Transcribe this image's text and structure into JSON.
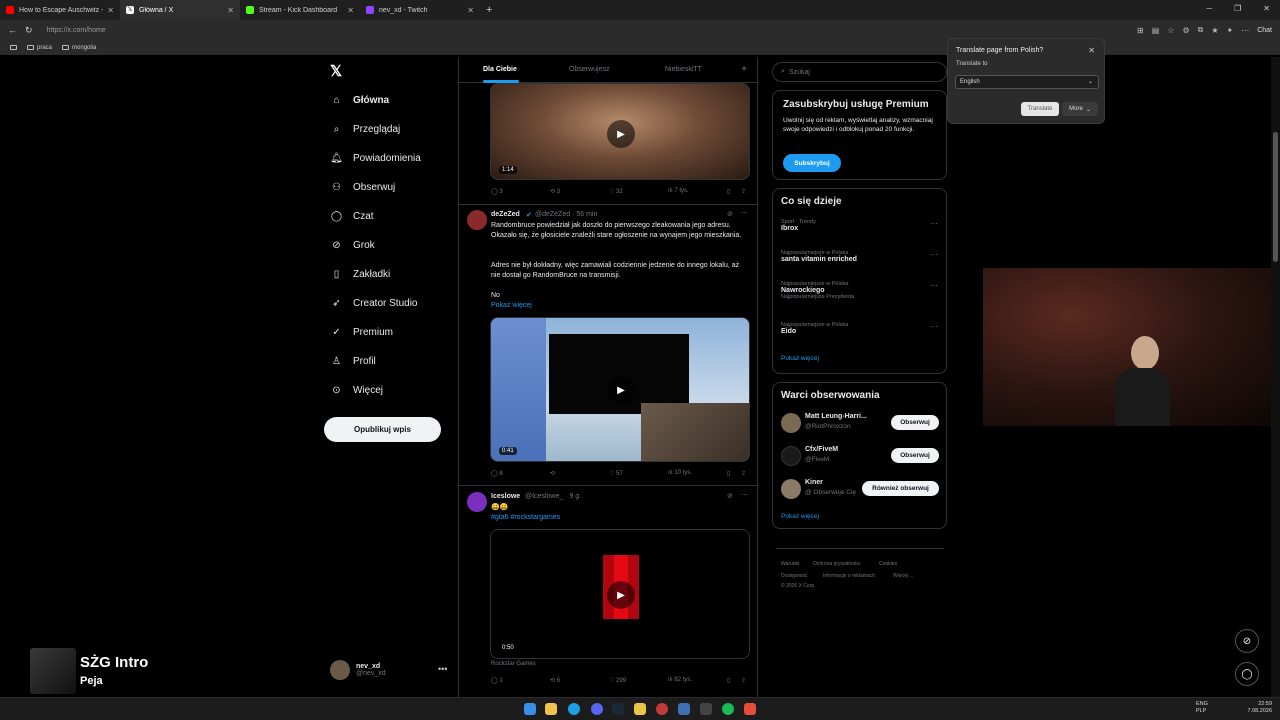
{
  "browser": {
    "tabs": [
      {
        "title": "How to Escape Auschwitz - YouTub",
        "color": "#ff0000"
      },
      {
        "title": "Główna / X",
        "color": "#ffffff"
      },
      {
        "title": "Stream - Kick Dashboard",
        "color": "#53fc18"
      },
      {
        "title": "nev_xd - Twitch",
        "color": "#9146ff"
      }
    ],
    "url": "https://x.com/home",
    "bookmarks": [
      "praca",
      "mongolia"
    ],
    "chat_label": "Chat"
  },
  "left_nav": {
    "items": [
      {
        "label": "Główna",
        "icon": "home-icon"
      },
      {
        "label": "Przeglądaj",
        "icon": "search-icon"
      },
      {
        "label": "Powiadomienia",
        "icon": "bell-icon"
      },
      {
        "label": "Obserwuj",
        "icon": "follow-icon"
      },
      {
        "label": "Czat",
        "icon": "chat-icon"
      },
      {
        "label": "Grok",
        "icon": "grok-icon"
      },
      {
        "label": "Zakładki",
        "icon": "bookmark-icon"
      },
      {
        "label": "Creator Studio",
        "icon": "creator-icon"
      },
      {
        "label": "Premium",
        "icon": "premium-icon"
      },
      {
        "label": "Profil",
        "icon": "profile-icon"
      },
      {
        "label": "Więcej",
        "icon": "more-icon"
      }
    ],
    "post_button": "Opublikuj wpis",
    "account": {
      "name": "nev_xd",
      "handle": "@nev_xd"
    }
  },
  "feed": {
    "tabs": [
      "Dla Ciebie",
      "Obserwujesz",
      "NiebieskiTT"
    ],
    "tweet1": {
      "duration": "1:14",
      "replies": "3",
      "reposts": "3",
      "likes": "32",
      "views": "7 tys."
    },
    "tweet2": {
      "name": "deZeZed",
      "handle": "@deZeZed · 56 min",
      "p1": "Randombruce powiedział jak doszło do pierwszego zleakowania jego adresu. Okazało się, że głosiciele znaleźli stare ogłoszenie na wynajem jego mieszkania.",
      "p2": "Adres nie był dokładny, więc zamawiali codziennie jedzenie do innego lokalu, aż nie dostał go RandomBruce na transmisji.",
      "p3": "No",
      "show_more": "Pokaż więcej",
      "duration": "0:41",
      "replies": "8",
      "reposts": "",
      "likes": "57",
      "views": "10 tys."
    },
    "tweet3": {
      "name": "Iceslowe",
      "handle": "@Iceslowe_ · 9 g.",
      "emoji": "😀😀",
      "hashtags": "#gta6 #rockstargames",
      "duration": "0:50",
      "source": "Rockstar Games",
      "replies": "1",
      "reposts": "6",
      "likes": "299",
      "views": "82 tys."
    }
  },
  "right": {
    "search_placeholder": "Szukaj",
    "premium": {
      "title": "Zasubskrybuj usługę Premium",
      "text": "Uwolnij się od reklam, wyświetlaj analizy, wzmacniaj swoje odpowiedzi i odblokuj ponad 20 funkcji.",
      "button": "Subskrybuj"
    },
    "trends": {
      "title": "Co się dzieje",
      "items": [
        {
          "cat": "Sport · Trendy",
          "name": "Ibrox",
          "extra": ""
        },
        {
          "cat": "Najpopularniejsze w Polska",
          "name": "santa vitamin enriched",
          "extra": ""
        },
        {
          "cat": "Najpopularniejsze w Polska",
          "name": "Nawrockiego",
          "extra": "Najpopularniejsze Prezydenta"
        },
        {
          "cat": "Najpopularniejsze w Polska",
          "name": "Eido",
          "extra": ""
        }
      ],
      "show_more": "Pokaż więcej"
    },
    "who_to_follow": {
      "title": "Warci obserwowania",
      "items": [
        {
          "name": "Matt Leung-Harri...",
          "handle": "@RiotPhroxzon",
          "button": "Obserwuj",
          "color": "#7a6a55"
        },
        {
          "name": "Cfx/FiveM",
          "handle": "@FiveM",
          "button": "Obserwuj",
          "color": "#1a1a1a"
        },
        {
          "name": "Kiner",
          "handle": "@ Obserwuje Cię",
          "button": "Również obserwuj",
          "color": "#8a7a66"
        }
      ],
      "show_more": "Pokaż więcej"
    },
    "footer": {
      "line1": [
        "Warunki",
        "Ochrona prywatności",
        "Cookies"
      ],
      "line2": [
        "Dostępność",
        "Informacje o reklamach",
        "Więcej ..."
      ],
      "line3": "© 2026 X Corp."
    }
  },
  "translate_popup": {
    "title": "Translate page from Polish?",
    "label": "Translate to",
    "language": "English",
    "translate": "Translate",
    "more": "More"
  },
  "overlay": {
    "title": "SŻG Intro",
    "artist": "Peja"
  },
  "taskbar": {
    "lang1": "ENG",
    "lang2": "PLP",
    "time": "22:59",
    "date": "7.08.2026"
  }
}
